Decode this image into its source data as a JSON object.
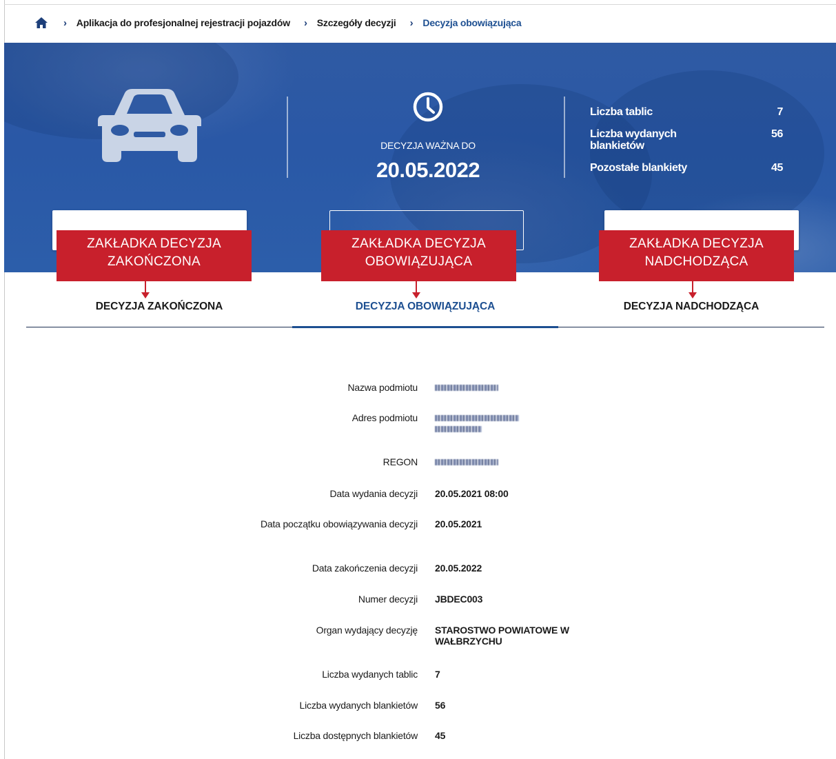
{
  "breadcrumb": {
    "items": [
      {
        "label": "Aplikacja do profesjonalnej rejestracji pojazdów"
      },
      {
        "label": "Szczegóły decyzji"
      },
      {
        "label": "Decyzja obowiązująca"
      }
    ]
  },
  "hero": {
    "valid_label": "DECYZJA WAŻNA DO",
    "valid_date": "20.05.2022",
    "stats": [
      {
        "label": "Liczba tablic",
        "value": "7"
      },
      {
        "label": "Liczba wydanych blankietów",
        "value": "56"
      },
      {
        "label": "Pozostałe blankiety",
        "value": "45"
      }
    ]
  },
  "annotations": [
    {
      "text": "ZAKŁADKA DECYZJA ZAKOŃCZONA"
    },
    {
      "text": "ZAKŁADKA DECYZJA OBOWIĄZUJĄCA"
    },
    {
      "text": "ZAKŁADKA DECYZJA NADCHODZĄCA"
    }
  ],
  "tabs": [
    {
      "label": "DECYZJA ZAKOŃCZONA",
      "active": false
    },
    {
      "label": "DECYZJA OBOWIĄZUJĄCA",
      "active": true
    },
    {
      "label": "DECYZJA NADCHODZĄCA",
      "active": false
    }
  ],
  "details": [
    {
      "label": "Nazwa podmiotu",
      "value": "",
      "redacted": true
    },
    {
      "label": "Adres podmiotu",
      "value": "",
      "redacted": true
    },
    {
      "label": "REGON",
      "value": "",
      "redacted": true
    },
    {
      "label": "Data wydania decyzji",
      "value": "20.05.2021 08:00"
    },
    {
      "label": "Data początku obowiązywania decyzji",
      "value": "20.05.2021"
    },
    {
      "label": "Data zakończenia decyzji",
      "value": "20.05.2022"
    },
    {
      "label": "Numer decyzji",
      "value": "JBDEC003"
    },
    {
      "label": "Organ wydający decyzję",
      "value": "STAROSTWO POWIATOWE W WAŁBRZYCHU"
    },
    {
      "label": "Liczba wydanych tablic",
      "value": "7"
    },
    {
      "label": "Liczba wydanych blankietów",
      "value": "56"
    },
    {
      "label": "Liczba dostępnych blankietów",
      "value": "45"
    }
  ],
  "colors": {
    "primary": "#1d4f91",
    "hero_bg": "#2c5aa5",
    "annotation": "#c8202c"
  }
}
